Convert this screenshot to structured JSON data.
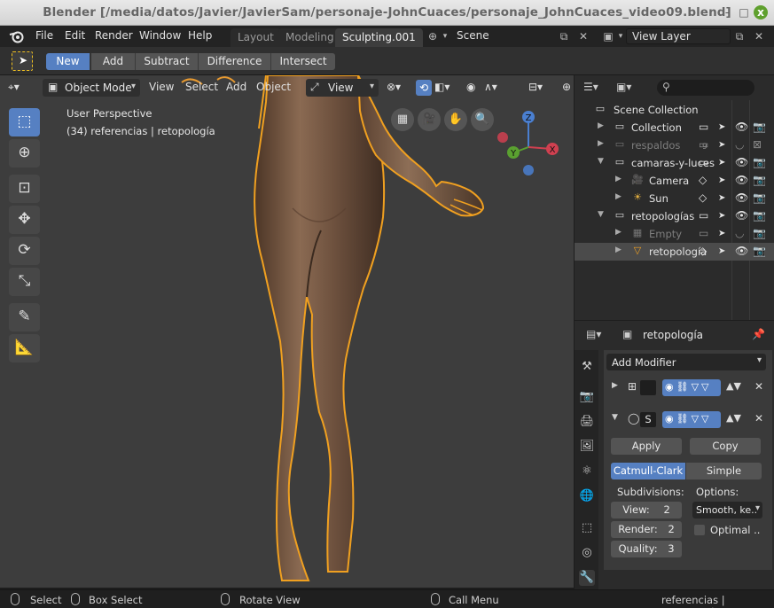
{
  "window": {
    "title": "Blender [/media/datos/Javier/JavierSam/personaje-JohnCuaces/personaje_JohnCuaces_video09.blend]",
    "minimize": "-",
    "maximize": "□",
    "close": "x"
  },
  "topbar": {
    "menus": [
      "File",
      "Edit",
      "Render",
      "Window",
      "Help"
    ],
    "workspaces": [
      "Layout",
      "Modeling",
      "Sculpting.001"
    ],
    "active_workspace": "Sculpting.001",
    "scene_label": "Scene",
    "view_layer_label": "View Layer"
  },
  "toolheader": {
    "modes": [
      "New",
      "Add",
      "Subtract",
      "Difference",
      "Intersect"
    ],
    "active_mode": "New"
  },
  "viewport": {
    "header": {
      "mode": "Object Mode",
      "menus": [
        "View",
        "Select",
        "Add",
        "Object"
      ],
      "orientation": "View"
    },
    "perspective_label": "User Perspective",
    "collection_info": "(34) referencias | retopología",
    "tools": [
      "select-box",
      "cursor",
      "move-all",
      "move",
      "rotate",
      "scale",
      "annotate",
      "measure"
    ],
    "gizmo_axes": [
      "X",
      "Y",
      "Z"
    ]
  },
  "outliner": {
    "search_placeholder": "",
    "root": "Scene Collection",
    "rows": [
      {
        "label": "Collection",
        "dim": false,
        "indent": 1,
        "icon": "collection-icon"
      },
      {
        "label": "respaldos",
        "dim": true,
        "indent": 1,
        "icon": "collection-icon",
        "badge": "9"
      },
      {
        "label": "camaras-y-luces",
        "dim": false,
        "indent": 1,
        "icon": "collection-icon"
      },
      {
        "label": "Camera",
        "dim": false,
        "indent": 2,
        "icon": "camera-icon"
      },
      {
        "label": "Sun",
        "dim": false,
        "indent": 2,
        "icon": "sun-icon"
      },
      {
        "label": "retopologías",
        "dim": false,
        "indent": 1,
        "icon": "collection-icon"
      },
      {
        "label": "Empty",
        "dim": true,
        "indent": 2,
        "icon": "empty-icon"
      },
      {
        "label": "retopología",
        "dim": false,
        "indent": 2,
        "icon": "mesh-icon",
        "selected": true
      }
    ]
  },
  "properties": {
    "object_name": "retopología",
    "add_modifier": "Add Modifier",
    "modifier2_letter": "S",
    "apply": "Apply",
    "copy": "Copy",
    "subdiv_types": [
      "Catmull-Clark",
      "Simple"
    ],
    "active_subdiv": "Catmull-Clark",
    "subdivisions_label": "Subdivisions:",
    "options_label": "Options:",
    "view_label": "View:",
    "view_value": "2",
    "render_label": "Render:",
    "render_value": "2",
    "quality_label": "Quality:",
    "quality_value": "3",
    "uv_smooth": "Smooth, ke..",
    "optimal_label": "Optimal .."
  },
  "statusbar": {
    "select": "Select",
    "box_select": "Box Select",
    "rotate_view": "Rotate View",
    "call_menu": "Call Menu",
    "info": "referencias | retopología"
  },
  "colors": {
    "accent": "#5680c2",
    "outline": "#f0a020",
    "skin": "#7a5a44",
    "viewport_bg": "#3d3d3d"
  }
}
